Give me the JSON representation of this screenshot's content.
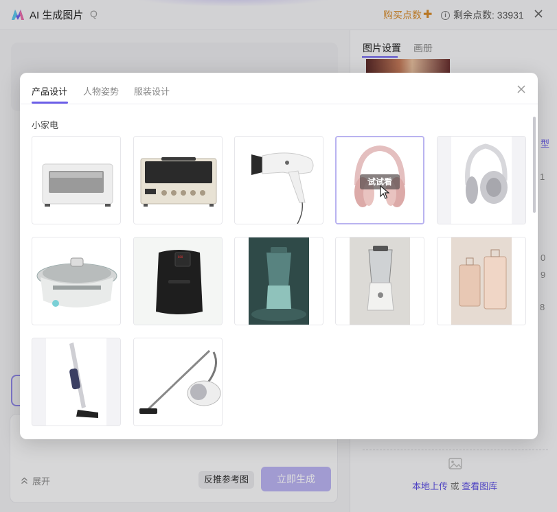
{
  "app": {
    "title": "AI 生成图片",
    "title_hint": "Q",
    "buy_label": "购买点数",
    "buy_plus": "✚",
    "points_label": "剩余点数: 33931"
  },
  "right_panel": {
    "tabs": [
      {
        "label": "图片设置",
        "active": true
      },
      {
        "label": "画册",
        "active": false
      }
    ],
    "peek": [
      "型",
      "1",
      "0",
      "9",
      "8"
    ],
    "upload": {
      "local": "本地上传",
      "or": "或",
      "gallery": "查看图库"
    }
  },
  "left_panel": {
    "expand_label": "展开",
    "reference_label": "反推参考图",
    "generate_label": "立即生成"
  },
  "modal": {
    "tabs": [
      {
        "label": "产品设计",
        "active": true
      },
      {
        "label": "人物姿势",
        "active": false
      },
      {
        "label": "服装设计",
        "active": false
      }
    ],
    "section_title": "小家电",
    "hover_label": "试试看",
    "items": [
      {
        "id": "toaster-oven-white"
      },
      {
        "id": "toaster-oven-cream"
      },
      {
        "id": "hair-dryer"
      },
      {
        "id": "headphones-pink",
        "hovered": true
      },
      {
        "id": "headphones-silver"
      },
      {
        "id": "hot-pot"
      },
      {
        "id": "air-fryer"
      },
      {
        "id": "blender-green"
      },
      {
        "id": "blender-white"
      },
      {
        "id": "luggage"
      },
      {
        "id": "stick-vacuum"
      },
      {
        "id": "canister-vacuum"
      }
    ]
  },
  "colors": {
    "accent": "#6b5ee8",
    "accent_light": "#b9b3f0",
    "buy": "#d4892a"
  }
}
